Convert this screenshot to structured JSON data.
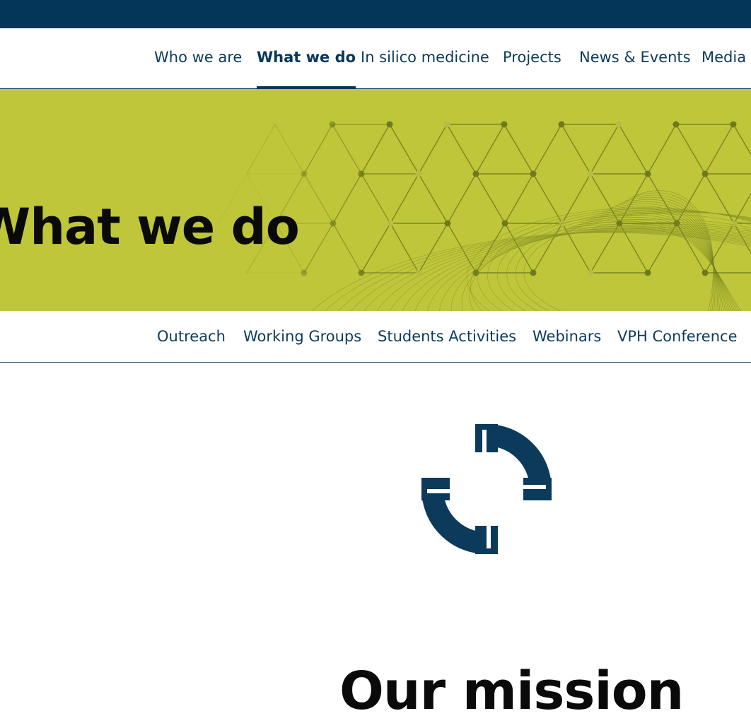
{
  "colors": {
    "navy": "#033658",
    "hero_bg": "#bfc63a",
    "hex_line": "#7c8720",
    "node": "#6e7a1c",
    "text_dark": "#0a0a0a"
  },
  "nav": {
    "items": [
      {
        "label": "Who we are"
      },
      {
        "label": "What we do",
        "active": true
      },
      {
        "label": "In silico medicine"
      },
      {
        "label": "Projects"
      },
      {
        "label": "News & Events"
      },
      {
        "label": "Media"
      }
    ]
  },
  "hero": {
    "title": "What we do"
  },
  "subnav": {
    "items": [
      {
        "label": "Outreach"
      },
      {
        "label": "Working Groups"
      },
      {
        "label": "Students Activities"
      },
      {
        "label": "Webinars"
      },
      {
        "label": "VPH Conference"
      }
    ]
  },
  "mission": {
    "icon": "mission-logo-icon",
    "title": "Our mission"
  }
}
